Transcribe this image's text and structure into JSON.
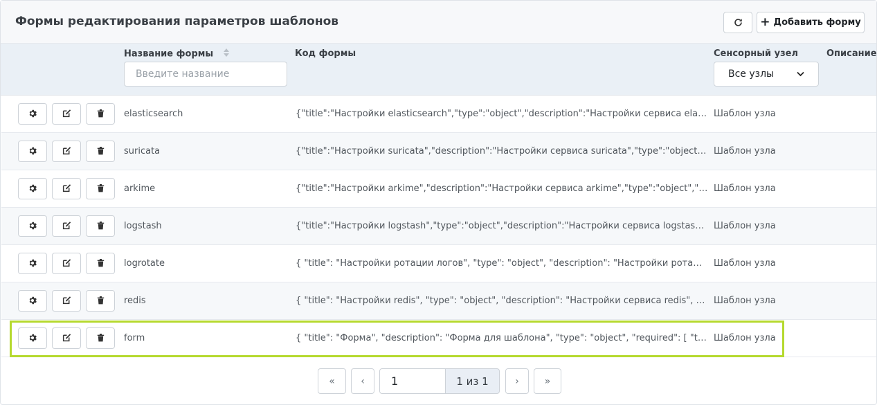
{
  "header": {
    "title": "Формы редактирования параметров шаблонов",
    "add_button_label": "Добавить форму",
    "add_button_icon": "plus-icon",
    "refresh_icon": "refresh-icon"
  },
  "columns": {
    "name": "Название формы",
    "code": "Код формы",
    "node": "Сенсорный узел",
    "description": "Описание"
  },
  "filters": {
    "name_placeholder": "Введите название",
    "node_selected": "Все узлы"
  },
  "rows": [
    {
      "name": "elasticsearch",
      "code": "{\"title\":\"Настройки elasticsearch\",\"type\":\"object\",\"description\":\"Настройки сервиса elasticsearch\"",
      "node": "Шаблон узла"
    },
    {
      "name": "suricata",
      "code": "{\"title\":\"Настройки suricata\",\"description\":\"Настройки сервиса suricata\",\"type\":\"object\",\"required\"",
      "node": "Шаблон узла"
    },
    {
      "name": "arkime",
      "code": "{\"title\":\"Настройки arkime\",\"description\":\"Настройки сервиса arkime\",\"type\":\"object\",\"required\"",
      "node": "Шаблон узла"
    },
    {
      "name": "logstash",
      "code": "{\"title\":\"Настройки logstash\",\"type\":\"object\",\"description\":\"Настройки сервиса logstash\",\"required\"",
      "node": "Шаблон узла"
    },
    {
      "name": "logrotate",
      "code": "{ \"title\": \"Настройки ротации логов\", \"type\": \"object\", \"description\": \"Настройки ротации логов\"",
      "node": "Шаблон узла"
    },
    {
      "name": "redis",
      "code": "{ \"title\": \"Настройки redis\", \"type\": \"object\", \"description\": \"Настройки сервиса redis\", \"required\"",
      "node": "Шаблон узла"
    },
    {
      "name": "form",
      "code": "{ \"title\": \"Форма\", \"description\": \"Форма для шаблона\", \"type\": \"object\", \"required\": [ \"test_name\"",
      "node": "Шаблон узла"
    }
  ],
  "pagination": {
    "first": "«",
    "prev": "‹",
    "next": "›",
    "last": "»",
    "page_value": "1",
    "page_info": "1 из 1"
  },
  "row_actions": [
    "gear-icon",
    "edit-icon",
    "trash-icon"
  ],
  "colors": {
    "highlight": "#b5d92e",
    "header_bg": "#eaf0f6"
  }
}
